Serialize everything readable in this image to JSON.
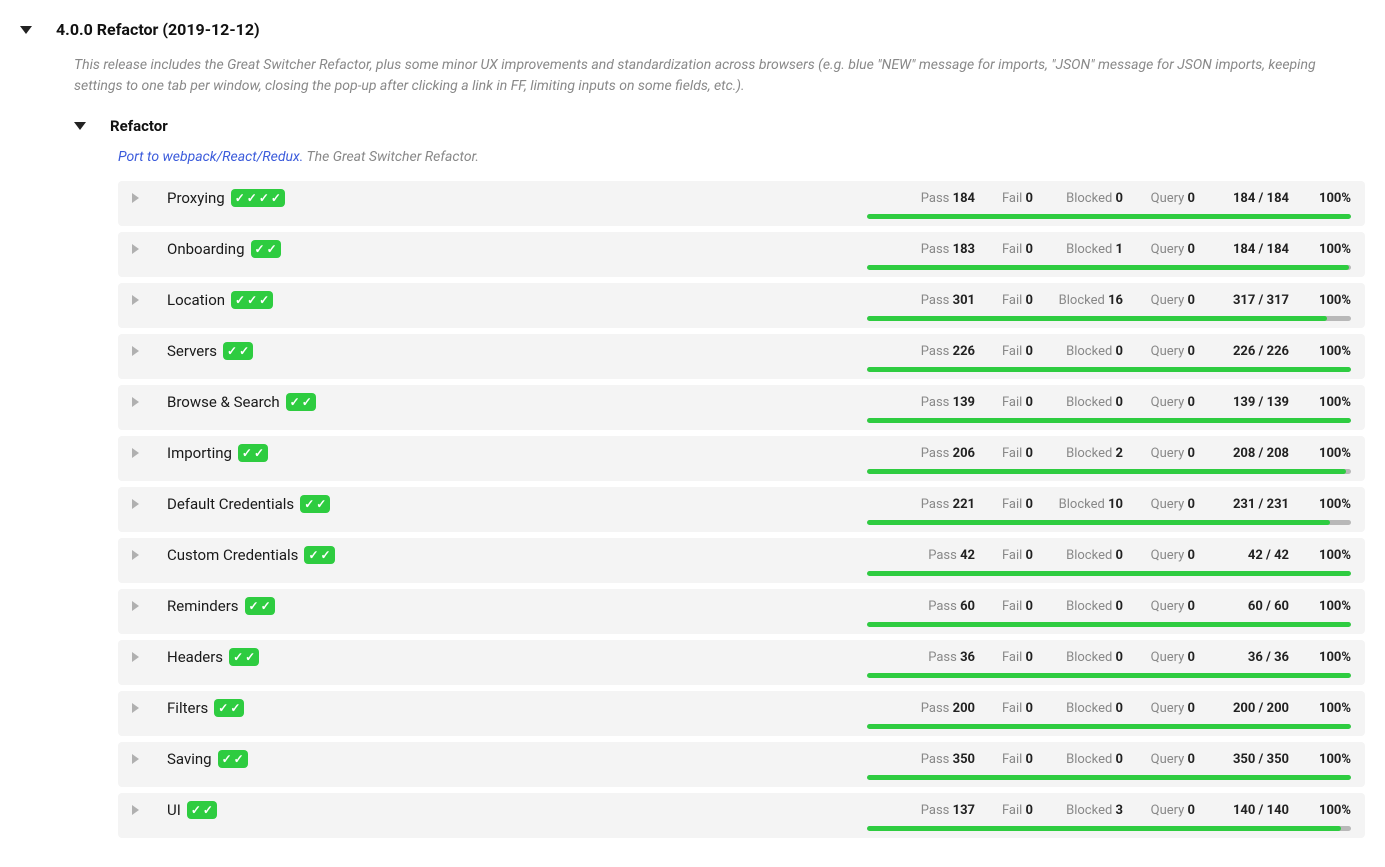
{
  "release": {
    "title": "4.0.0 Refactor (2019-12-12)",
    "description": "This release includes the Great Switcher Refactor, plus some minor UX improvements and standardization across browsers (e.g. blue \"NEW\" message for imports, \"JSON\" message for JSON imports, keeping settings to one tab per window, closing the pop-up after clicking a link in FF, limiting inputs on some fields, etc.)."
  },
  "section": {
    "title": "Refactor",
    "link_text": "Port to webpack/React/Redux.",
    "desc_rest": " The Great Switcher Refactor."
  },
  "labels": {
    "pass": "Pass",
    "fail": "Fail",
    "blocked": "Blocked",
    "query": "Query"
  },
  "tests": [
    {
      "name": "Proxying",
      "checks": 4,
      "pass": 184,
      "fail": 0,
      "blocked": 0,
      "query": 0,
      "done": 184,
      "total": 184,
      "pct": "100%",
      "fill": 100
    },
    {
      "name": "Onboarding",
      "checks": 2,
      "pass": 183,
      "fail": 0,
      "blocked": 1,
      "query": 0,
      "done": 184,
      "total": 184,
      "pct": "100%",
      "fill": 99.5
    },
    {
      "name": "Location",
      "checks": 3,
      "pass": 301,
      "fail": 0,
      "blocked": 16,
      "query": 0,
      "done": 317,
      "total": 317,
      "pct": "100%",
      "fill": 95
    },
    {
      "name": "Servers",
      "checks": 2,
      "pass": 226,
      "fail": 0,
      "blocked": 0,
      "query": 0,
      "done": 226,
      "total": 226,
      "pct": "100%",
      "fill": 100
    },
    {
      "name": "Browse & Search",
      "checks": 2,
      "pass": 139,
      "fail": 0,
      "blocked": 0,
      "query": 0,
      "done": 139,
      "total": 139,
      "pct": "100%",
      "fill": 100
    },
    {
      "name": "Importing",
      "checks": 2,
      "pass": 206,
      "fail": 0,
      "blocked": 2,
      "query": 0,
      "done": 208,
      "total": 208,
      "pct": "100%",
      "fill": 99
    },
    {
      "name": "Default Credentials",
      "checks": 2,
      "pass": 221,
      "fail": 0,
      "blocked": 10,
      "query": 0,
      "done": 231,
      "total": 231,
      "pct": "100%",
      "fill": 95.7
    },
    {
      "name": "Custom Credentials",
      "checks": 2,
      "pass": 42,
      "fail": 0,
      "blocked": 0,
      "query": 0,
      "done": 42,
      "total": 42,
      "pct": "100%",
      "fill": 100
    },
    {
      "name": "Reminders",
      "checks": 2,
      "pass": 60,
      "fail": 0,
      "blocked": 0,
      "query": 0,
      "done": 60,
      "total": 60,
      "pct": "100%",
      "fill": 100
    },
    {
      "name": "Headers",
      "checks": 2,
      "pass": 36,
      "fail": 0,
      "blocked": 0,
      "query": 0,
      "done": 36,
      "total": 36,
      "pct": "100%",
      "fill": 100
    },
    {
      "name": "Filters",
      "checks": 2,
      "pass": 200,
      "fail": 0,
      "blocked": 0,
      "query": 0,
      "done": 200,
      "total": 200,
      "pct": "100%",
      "fill": 100
    },
    {
      "name": "Saving",
      "checks": 2,
      "pass": 350,
      "fail": 0,
      "blocked": 0,
      "query": 0,
      "done": 350,
      "total": 350,
      "pct": "100%",
      "fill": 100
    },
    {
      "name": "UI",
      "checks": 2,
      "pass": 137,
      "fail": 0,
      "blocked": 3,
      "query": 0,
      "done": 140,
      "total": 140,
      "pct": "100%",
      "fill": 97.9
    }
  ]
}
